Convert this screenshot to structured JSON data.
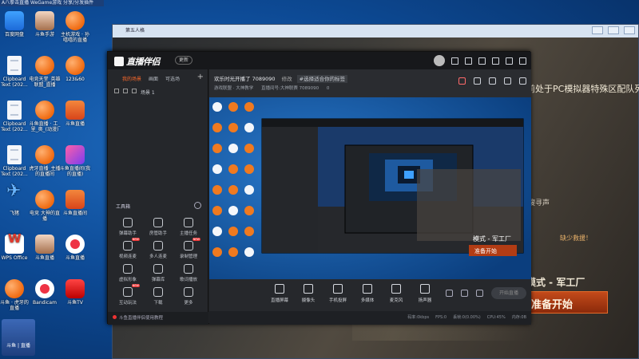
{
  "desktop": {
    "topstrip": "A八拳击直播  WeGame游戏  分享/分发插件",
    "icons": [
      {
        "label": "百度网盘",
        "style": "blue"
      },
      {
        "label": "斗鱼手游",
        "style": "face"
      },
      {
        "label": "主机游戏 · 孙嘻嘻的直播",
        "style": "orange"
      },
      {
        "label": "Clipboard Text (202...",
        "style": "doc"
      },
      {
        "label": "电竞天堂_英雄联盟_直播",
        "style": "orange"
      },
      {
        "label": "123&60",
        "style": "orange"
      },
      {
        "label": "Clipboard Text (202...",
        "style": "doc"
      },
      {
        "label": "斗鱼直播 · 工_里_奥_(动漫)",
        "style": "orange"
      },
      {
        "label": "斗鱼直播",
        "style": "zhi"
      },
      {
        "label": "Clipboard Text (202...",
        "style": "doc"
      },
      {
        "label": "虎牙直播_主播的直播间",
        "style": "orange"
      },
      {
        "label": "斗鱼直播间(我的直播)",
        "style": "pink"
      },
      {
        "label": "飞猪",
        "style": "plane"
      },
      {
        "label": "电竞  大神的直播",
        "style": "orange"
      },
      {
        "label": "斗鱼直播间",
        "style": "zhi"
      },
      {
        "label": "WPS Office",
        "style": "wps"
      },
      {
        "label": "斗鱼直播",
        "style": "face"
      },
      {
        "label": "斗鱼直播",
        "style": "cam"
      },
      {
        "label": "斗鱼 · 虎牙的直播",
        "style": "orange"
      },
      {
        "label": "Bandicam",
        "style": "cam"
      },
      {
        "label": "斗鱼TV",
        "style": "tv"
      }
    ],
    "watermark": "斗鱼 | 直播"
  },
  "game_window": {
    "title": "第五人格",
    "text_lines": [
      "前处于PC模拟器特殊区配队列",
      "搜寻声",
      "模式 - 军工厂",
      "缺少救援！"
    ],
    "button": "准备开始"
  },
  "app": {
    "logo": "直播伴侣",
    "version": "更新",
    "side_tabs": [
      "我的场景",
      "画面",
      "可选场"
    ],
    "scene_item": "场景 1",
    "tools_header": "工具箱",
    "tools": [
      {
        "label": "弹幕助手",
        "new": false
      },
      {
        "label": "房管助手",
        "new": false
      },
      {
        "label": "主播任务",
        "new": false
      },
      {
        "label": "视频连麦",
        "new": true
      },
      {
        "label": "多人连麦",
        "new": false
      },
      {
        "label": "录制管理",
        "new": true
      },
      {
        "label": "虚拟形象",
        "new": false
      },
      {
        "label": "弹幕库",
        "new": false
      },
      {
        "label": "歌词播放",
        "new": false
      },
      {
        "label": "互动玩法",
        "new": true
      },
      {
        "label": "下载",
        "new": false
      },
      {
        "label": "更多",
        "new": false
      }
    ],
    "side_footer": "斗鱼直播伴侣使用教程",
    "room": {
      "title": "欢乐时光开播了 7089090",
      "edit": "修改",
      "tag": "#选择适合你的标签",
      "category": "游戏联盟 · 大神教学",
      "room_line": "直播间号:大神联赛 7089090",
      "fans": "0"
    },
    "controls": [
      {
        "label": "直播屏幕"
      },
      {
        "label": "摄像头"
      },
      {
        "label": "手机投屏"
      },
      {
        "label": "多媒体"
      },
      {
        "label": "麦克风"
      },
      {
        "label": "扬声器"
      }
    ],
    "start_label": "开始直播",
    "status": [
      "码率:0kbps",
      "FPS:0",
      "丢帧:0(0.00%)",
      "CPU:45%",
      "内存:0B"
    ]
  }
}
